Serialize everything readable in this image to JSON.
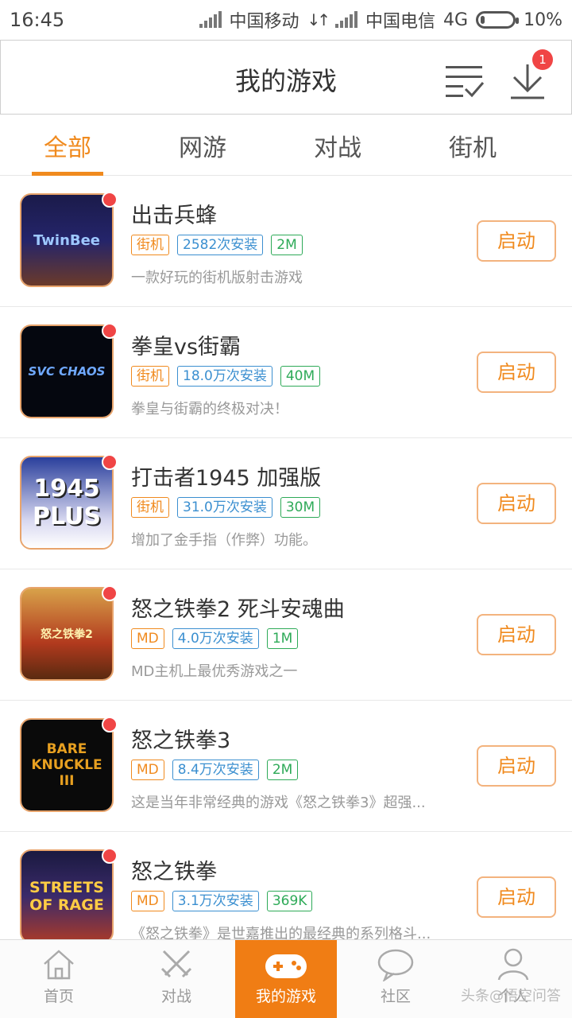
{
  "status_bar": {
    "time": "16:45",
    "carrier1": "中国移动",
    "carrier2": "中国电信",
    "network": "4G",
    "battery": "10%"
  },
  "header": {
    "title": "我的游戏",
    "download_badge": "1"
  },
  "tabs": [
    {
      "label": "全部",
      "active": true
    },
    {
      "label": "网游",
      "active": false
    },
    {
      "label": "对战",
      "active": false
    },
    {
      "label": "街机",
      "active": false
    }
  ],
  "games": [
    {
      "name": "出击兵蜂",
      "category": "街机",
      "installs": "2582次安装",
      "size": "2M",
      "description": "一款好玩的街机版射击游戏",
      "art_text": "TwinBee",
      "launch": "启动"
    },
    {
      "name": "拳皇vs街霸",
      "category": "街机",
      "installs": "18.0万次安装",
      "size": "40M",
      "description": "拳皇与街霸的终极对决！",
      "art_text": "SVC CHAOS",
      "launch": "启动"
    },
    {
      "name": "打击者1945 加强版",
      "category": "街机",
      "installs": "31.0万次安装",
      "size": "30M",
      "description": "增加了金手指（作弊）功能。",
      "art_text": "1945 PLUS",
      "launch": "启动"
    },
    {
      "name": "怒之铁拳2 死斗安魂曲",
      "category": "MD",
      "installs": "4.0万次安装",
      "size": "1M",
      "description": "MD主机上最优秀游戏之一",
      "art_text": "怒之铁拳2",
      "launch": "启动"
    },
    {
      "name": "怒之铁拳3",
      "category": "MD",
      "installs": "8.4万次安装",
      "size": "2M",
      "description": "这是当年非常经典的游戏《怒之铁拳3》超强...",
      "art_text": "BARE KNUCKLE III",
      "launch": "启动"
    },
    {
      "name": "怒之铁拳",
      "category": "MD",
      "installs": "3.1万次安装",
      "size": "369K",
      "description": "《怒之铁拳》是世嘉推出的最经典的系列格斗...",
      "art_text": "STREETS OF RAGE",
      "launch": "启动"
    }
  ],
  "bottom_nav": [
    {
      "label": "首页",
      "icon": "home-icon",
      "active": false
    },
    {
      "label": "对战",
      "icon": "crossed-swords-icon",
      "active": false
    },
    {
      "label": "我的游戏",
      "icon": "gamepad-icon",
      "active": true
    },
    {
      "label": "社区",
      "icon": "chat-bubble-icon",
      "active": false
    },
    {
      "label": "个人",
      "icon": "person-icon",
      "active": false
    }
  ],
  "watermark": "头条@悟空问答",
  "colors": {
    "accent": "#f08a1e",
    "nav_active_bg": "#f07d14",
    "badge_red": "#f04545",
    "install_blue": "#3b8fd0",
    "size_green": "#2eaa58"
  }
}
